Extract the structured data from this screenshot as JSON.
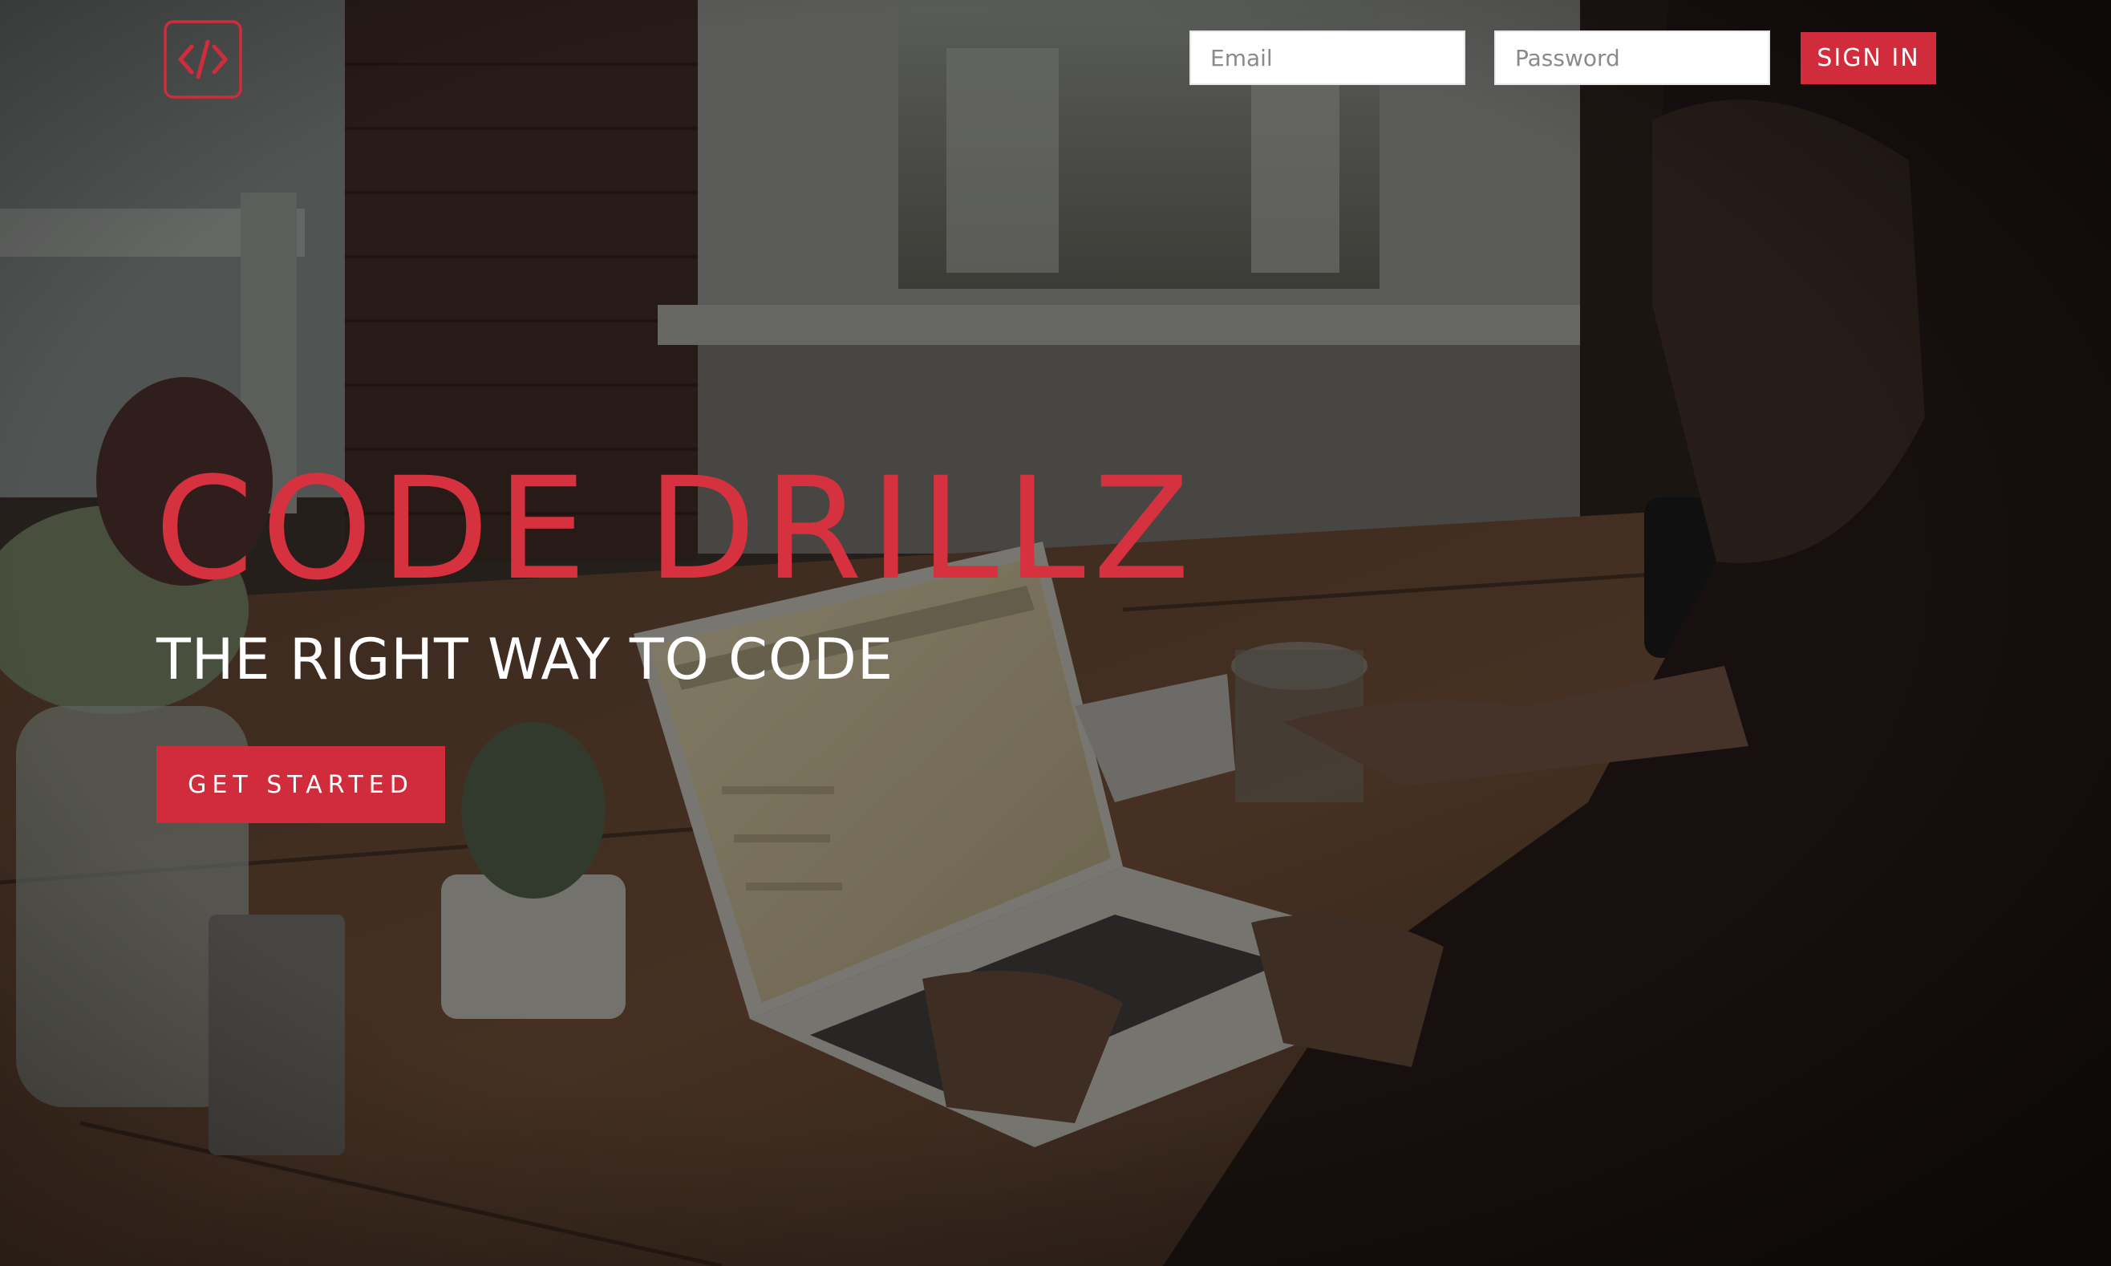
{
  "brand": {
    "logo_icon": "code-brackets-icon",
    "title": "CODE DRILLZ",
    "tagline": "THE RIGHT WAY TO CODE"
  },
  "header": {
    "email_placeholder": "Email",
    "password_placeholder": "Password",
    "signin_label": "SIGN IN"
  },
  "hero": {
    "cta_label": "GET STARTED"
  },
  "colors": {
    "accent": "#d12c3b",
    "text_light": "#ffffff"
  }
}
